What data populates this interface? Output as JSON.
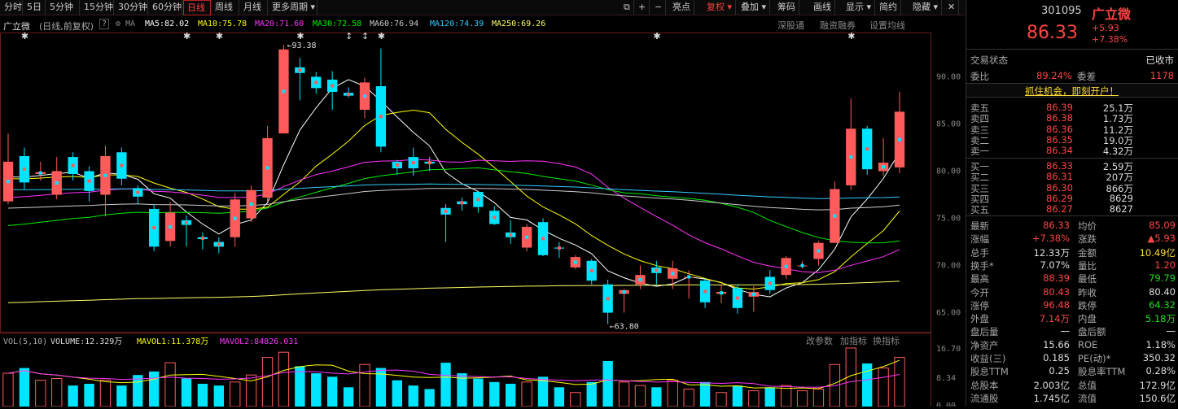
{
  "toolbar": {
    "periods": [
      "分时",
      "5日",
      "5分钟",
      "15分钟",
      "30分钟",
      "60分钟",
      "日线",
      "周线",
      "月线",
      "更多周期"
    ],
    "active": "日线",
    "tools": [
      "亮点",
      "复权",
      "叠加",
      "筹码",
      "画线",
      "显示",
      "简约",
      "隐藏"
    ]
  },
  "infobar": {
    "stock": "广立微",
    "mode": "(日线,前复权)",
    "help": "?",
    "ma5": "MA5:82.02",
    "ma10": "MA10:75.78",
    "ma20": "MA20:71.60",
    "ma30": "MA30:72.58",
    "ma60": "MA60:76.94",
    "ma120": "MA120:74.39",
    "ma250": "MA250:69.26",
    "links": [
      "深股通",
      "融资融券",
      "设置均线"
    ]
  },
  "volbar": {
    "vol": "VOL(5,10)",
    "volume": "VOLUME:12.329万",
    "mavol1": "MAVOL1:11.378万",
    "mavol2": "MAVOL2:84826.031",
    "links": [
      "改参数",
      "加指标",
      "换指标"
    ]
  },
  "colors": {
    "up": "#ff5b5b",
    "down": "#00e5ff",
    "ma5": "#ffffff",
    "ma10": "#ffff00",
    "ma20": "#ff33ff",
    "ma30": "#00ee00",
    "ma60": "#cccccc",
    "ma120": "#33ccff",
    "ma250": "#ffff66"
  },
  "chart_data": {
    "type": "candlestick",
    "ylim": [
      63.5,
      94
    ],
    "yticks": [
      90.0,
      85.0,
      80.0,
      75.0,
      70.0,
      65.0
    ],
    "annotations": {
      "high": "93.38",
      "low": "63.80"
    },
    "candles": [
      {
        "o": 76.8,
        "c": 81.0,
        "h": 84.0,
        "l": 76.5
      },
      {
        "o": 81.6,
        "c": 78.8,
        "h": 82.5,
        "l": 78.0
      },
      {
        "o": 79.7,
        "c": 79.9,
        "h": 81.0,
        "l": 79.0
      },
      {
        "o": 77.5,
        "c": 80.0,
        "h": 81.5,
        "l": 77.0
      },
      {
        "o": 81.5,
        "c": 79.7,
        "h": 82.0,
        "l": 79.0
      },
      {
        "o": 80.0,
        "c": 77.9,
        "h": 80.5,
        "l": 76.8
      },
      {
        "o": 77.5,
        "c": 81.6,
        "h": 82.7,
        "l": 75.2
      },
      {
        "o": 82.0,
        "c": 79.2,
        "h": 82.5,
        "l": 78.5
      },
      {
        "o": 78.2,
        "c": 77.3,
        "h": 78.5,
        "l": 76.5
      },
      {
        "o": 76.0,
        "c": 72.0,
        "h": 76.5,
        "l": 71.5
      },
      {
        "o": 72.6,
        "c": 75.6,
        "h": 76.7,
        "l": 72.0
      },
      {
        "o": 74.8,
        "c": 74.3,
        "h": 75.3,
        "l": 72.0
      },
      {
        "o": 73.0,
        "c": 72.8,
        "h": 73.5,
        "l": 71.7
      },
      {
        "o": 72.5,
        "c": 72.0,
        "h": 73.0,
        "l": 71.3
      },
      {
        "o": 73.0,
        "c": 77.0,
        "h": 77.7,
        "l": 72.0
      },
      {
        "o": 75.0,
        "c": 78.0,
        "h": 78.5,
        "l": 74.6
      },
      {
        "o": 77.2,
        "c": 83.5,
        "h": 84.8,
        "l": 76.8
      },
      {
        "o": 84.0,
        "c": 92.9,
        "h": 93.38,
        "l": 84.0
      },
      {
        "o": 91.0,
        "c": 90.4,
        "h": 92.0,
        "l": 87.5
      },
      {
        "o": 90.0,
        "c": 88.8,
        "h": 90.5,
        "l": 88.2
      },
      {
        "o": 89.7,
        "c": 88.4,
        "h": 90.6,
        "l": 86.5
      },
      {
        "o": 88.3,
        "c": 88.0,
        "h": 88.9,
        "l": 87.8
      },
      {
        "o": 86.5,
        "c": 89.4,
        "h": 89.9,
        "l": 85.6
      },
      {
        "o": 89.0,
        "c": 82.6,
        "h": 93.0,
        "l": 82.0
      },
      {
        "o": 81.0,
        "c": 80.3,
        "h": 81.2,
        "l": 79.6
      },
      {
        "o": 81.5,
        "c": 80.3,
        "h": 82.5,
        "l": 79.5
      },
      {
        "o": 81.0,
        "c": 80.8,
        "h": 81.5,
        "l": 80.0
      },
      {
        "o": 76.1,
        "c": 75.4,
        "h": 76.5,
        "l": 72.5
      },
      {
        "o": 76.8,
        "c": 76.5,
        "h": 77.2,
        "l": 75.8
      },
      {
        "o": 77.8,
        "c": 76.2,
        "h": 77.9,
        "l": 75.6
      },
      {
        "o": 75.8,
        "c": 74.4,
        "h": 76.3,
        "l": 74.3
      },
      {
        "o": 73.5,
        "c": 73.0,
        "h": 74.8,
        "l": 72.3
      },
      {
        "o": 71.9,
        "c": 74.1,
        "h": 74.4,
        "l": 71.5
      },
      {
        "o": 74.6,
        "c": 71.1,
        "h": 75.0,
        "l": 71.0
      },
      {
        "o": 71.9,
        "c": 71.8,
        "h": 72.5,
        "l": 70.8
      },
      {
        "o": 69.8,
        "c": 70.9,
        "h": 71.1,
        "l": 69.6
      },
      {
        "o": 70.5,
        "c": 68.4,
        "h": 70.7,
        "l": 68.0
      },
      {
        "o": 68.0,
        "c": 65.0,
        "h": 68.5,
        "l": 63.8
      },
      {
        "o": 67.0,
        "c": 67.4,
        "h": 67.5,
        "l": 65.0
      },
      {
        "o": 68.0,
        "c": 69.0,
        "h": 70.0,
        "l": 67.5
      },
      {
        "o": 69.8,
        "c": 69.2,
        "h": 70.5,
        "l": 68.0
      },
      {
        "o": 68.6,
        "c": 69.7,
        "h": 70.5,
        "l": 67.5
      },
      {
        "o": 68.8,
        "c": 68.8,
        "h": 69.5,
        "l": 66.5
      },
      {
        "o": 68.4,
        "c": 66.1,
        "h": 68.6,
        "l": 65.5
      },
      {
        "o": 67.0,
        "c": 67.2,
        "h": 68.0,
        "l": 66.0
      },
      {
        "o": 67.6,
        "c": 65.5,
        "h": 68.0,
        "l": 64.9
      },
      {
        "o": 66.7,
        "c": 67.2,
        "h": 67.8,
        "l": 65.1
      },
      {
        "o": 68.8,
        "c": 67.4,
        "h": 69.5,
        "l": 67.0
      },
      {
        "o": 69.0,
        "c": 70.8,
        "h": 71.0,
        "l": 68.6
      },
      {
        "o": 70.0,
        "c": 70.0,
        "h": 70.5,
        "l": 69.7
      },
      {
        "o": 70.7,
        "c": 72.4,
        "h": 72.6,
        "l": 70.0
      },
      {
        "o": 72.4,
        "c": 78.1,
        "h": 78.9,
        "l": 72.4
      },
      {
        "o": 78.5,
        "c": 84.5,
        "h": 87.7,
        "l": 78.0
      },
      {
        "o": 84.5,
        "c": 80.2,
        "h": 84.8,
        "l": 79.6
      },
      {
        "o": 80.0,
        "c": 80.9,
        "h": 83.5,
        "l": 79.5
      },
      {
        "o": 80.4,
        "c": 86.3,
        "h": 88.4,
        "l": 79.8
      }
    ],
    "volumes": [
      9.5,
      11.0,
      7.5,
      8.0,
      6.0,
      6.5,
      7.5,
      6.0,
      9.0,
      10.0,
      12.5,
      8.0,
      6.5,
      6.0,
      7.0,
      9.0,
      14.0,
      15.5,
      11.5,
      9.5,
      8.5,
      5.5,
      12.0,
      11.0,
      7.5,
      6.0,
      5.0,
      12.5,
      9.5,
      8.0,
      7.0,
      6.5,
      7.0,
      8.5,
      5.5,
      4.0,
      7.0,
      13.0,
      7.0,
      6.0,
      5.5,
      7.5,
      5.0,
      7.0,
      4.0,
      6.0,
      4.5,
      5.5,
      6.0,
      4.5,
      5.0,
      12.0,
      16.7,
      12.3,
      11.0,
      14.0
    ],
    "vol_ymax": 16.7,
    "vol_ticks": [
      "16.70",
      "8.34",
      "0.00"
    ]
  },
  "quote": {
    "code": "301095",
    "name": "广立微",
    "price": "86.33",
    "chg": "+5.93",
    "pct": "+7.38%",
    "status_label": "交易状态",
    "status": "已收市",
    "webi_label": "委比",
    "webi": "89.24%",
    "wecha_label": "委差",
    "wecha": "1178",
    "banner": "抓住机会，即刻开户！",
    "sells": [
      [
        "卖五",
        "86.39",
        "25.1万"
      ],
      [
        "卖四",
        "86.38",
        "1.73万"
      ],
      [
        "卖三",
        "86.36",
        "11.2万"
      ],
      [
        "卖二",
        "86.35",
        "19.0万"
      ],
      [
        "卖一",
        "86.34",
        "4.32万"
      ]
    ],
    "buys": [
      [
        "买一",
        "86.33",
        "2.59万"
      ],
      [
        "买二",
        "86.31",
        "207万"
      ],
      [
        "买三",
        "86.30",
        "866万"
      ],
      [
        "买四",
        "86.29",
        "8629"
      ],
      [
        "买五",
        "86.27",
        "8627"
      ]
    ],
    "stats": [
      [
        "最新",
        "86.33",
        "red",
        "均价",
        "85.09",
        "red"
      ],
      [
        "涨幅",
        "+7.38%",
        "red",
        "涨跌",
        "▲5.93",
        "red"
      ],
      [
        "总手",
        "12.33万",
        "wht",
        "金额",
        "10.49亿",
        "yel"
      ],
      [
        "换手*",
        "7.07%",
        "wht",
        "量比",
        "1.20",
        "red"
      ],
      [
        "最高",
        "88.39",
        "red",
        "最低",
        "79.79",
        "grn"
      ],
      [
        "今开",
        "80.43",
        "red",
        "昨收",
        "80.40",
        "wht"
      ],
      [
        "涨停",
        "96.48",
        "red",
        "跌停",
        "64.32",
        "grn"
      ],
      [
        "外盘",
        "7.14万",
        "red",
        "内盘",
        "5.18万",
        "grn"
      ],
      [
        "盘后量",
        "一",
        "wht",
        "盘后额",
        "一",
        "wht"
      ],
      [
        "净资产",
        "15.66",
        "wht",
        "ROE",
        "1.18%",
        "wht"
      ],
      [
        "收益(三)",
        "0.185",
        "wht",
        "PE(动)*",
        "350.32",
        "wht"
      ],
      [
        "股息TTM",
        "0.25",
        "wht",
        "股息率TTM",
        "0.28%",
        "wht"
      ],
      [
        "总股本",
        "2.003亿",
        "wht",
        "总值",
        "172.9亿",
        "wht"
      ],
      [
        "流通股",
        "1.745亿",
        "wht",
        "流值",
        "150.6亿",
        "wht"
      ]
    ]
  }
}
